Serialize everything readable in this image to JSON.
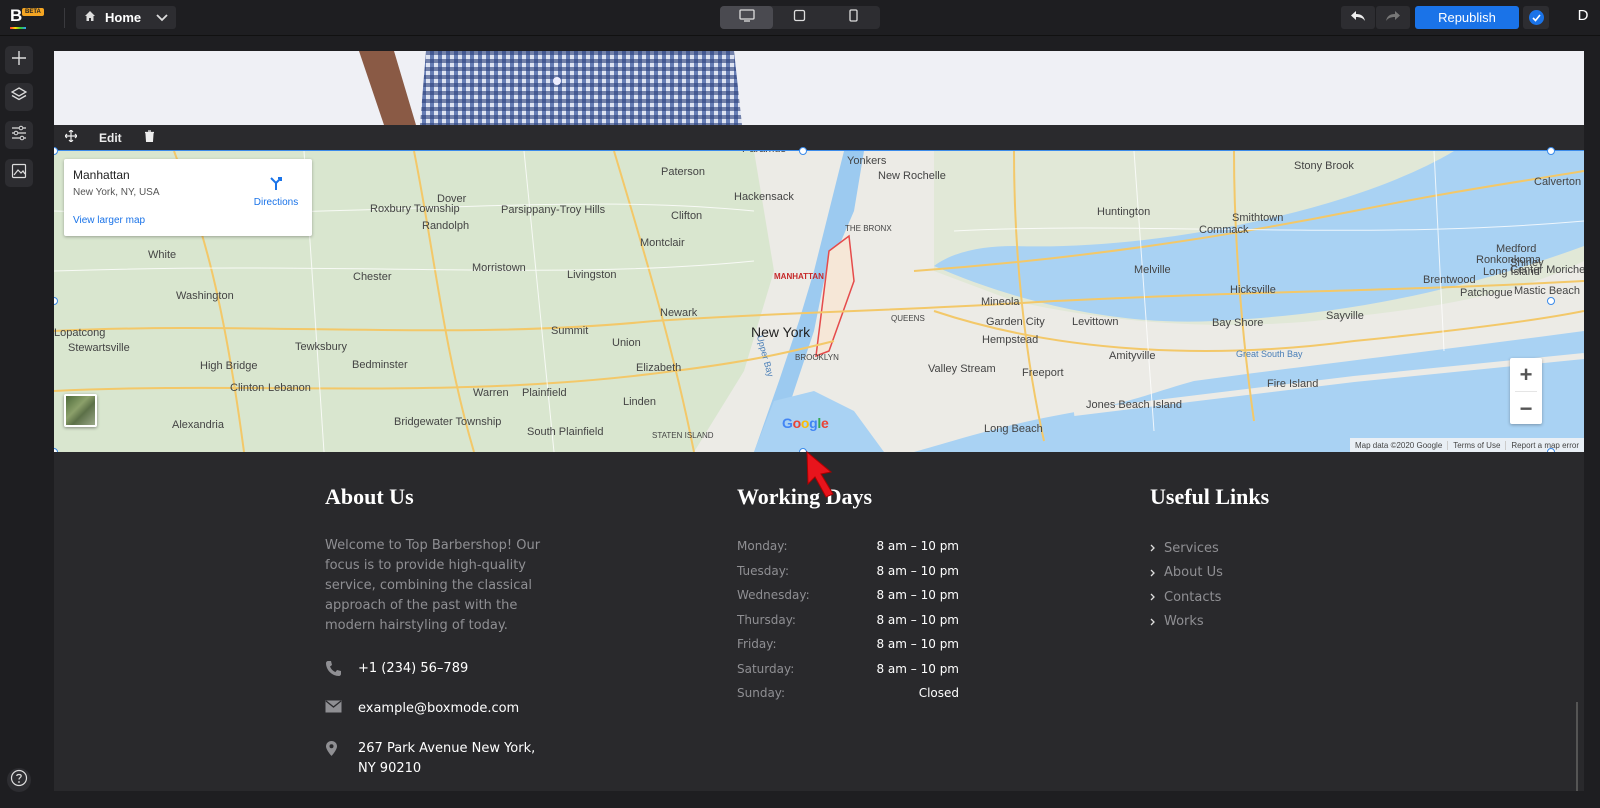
{
  "app": {
    "logo": "B",
    "beta": "BETA",
    "avatar_initial": "D"
  },
  "toolbar": {
    "page_select": "Home",
    "republish": "Republish"
  },
  "editbar": {
    "edit_label": "Edit"
  },
  "map": {
    "card_title": "Manhattan",
    "card_subtitle": "New York, NY, USA",
    "card_link": "View larger map",
    "directions": "Directions",
    "google": [
      "G",
      "o",
      "o",
      "g",
      "l",
      "e"
    ],
    "attribution": [
      "Map data ©2020 Google",
      "Terms of Use",
      "Report a map error"
    ],
    "labels": [
      "Paramus",
      "Yonkers",
      "New Rochelle",
      "Paterson",
      "Hackensack",
      "Dover",
      "Roxbury Township",
      "Parsippany-Troy Hills",
      "Clifton",
      "Randolph",
      "Montclair",
      "Huntington",
      "Smithtown",
      "Commack",
      "Stony Brook",
      "Calverton",
      "Medford",
      "Ronkonkoma",
      "Long Island",
      "Shirley",
      "Center Moriches",
      "Mastic Beach",
      "Patchogue",
      "Brentwood",
      "Melville",
      "Hicksville",
      "THE BRONX",
      "MANHATTAN",
      "Morristown",
      "Livingston",
      "Chester",
      "Washington",
      "White",
      "Newark",
      "New York",
      "QUEENS",
      "BROOKLYN",
      "Mineola",
      "Garden City",
      "Levittown",
      "Hempstead",
      "Bay Shore",
      "Sayville",
      "Lopatcong",
      "Stewartsville",
      "Tewksbury",
      "Bedminster",
      "Summit",
      "Union",
      "Elizabeth",
      "Valley Stream",
      "Freeport",
      "Amityville",
      "Great South Bay",
      "Fire Island",
      "High Bridge",
      "Clinton",
      "Lebanon",
      "Warren",
      "Plainfield",
      "Linden",
      "Jones Beach Island",
      "Long Beach",
      "Alexandria",
      "Bridgewater Township",
      "South Plainfield",
      "STATEN ISLAND",
      "Upper Bay"
    ]
  },
  "footer": {
    "about": {
      "title": "About Us",
      "text": "Welcome to Top Barbershop! Our focus is to provide high-quality service, combining the classical approach of the past with the modern hairstyling of today.",
      "phone": "+1 (234) 56–789",
      "email": "example@boxmode.com",
      "address": "267 Park Avenue New York, NY 90210"
    },
    "hours": {
      "title": "Working Days",
      "days": [
        {
          "day": "Monday:",
          "hours": "8 am – 10 pm"
        },
        {
          "day": "Tuesday:",
          "hours": "8 am – 10 pm"
        },
        {
          "day": "Wednesday:",
          "hours": "8 am – 10 pm"
        },
        {
          "day": "Thursday:",
          "hours": "8 am – 10 pm"
        },
        {
          "day": "Friday:",
          "hours": "8 am – 10 pm"
        },
        {
          "day": "Saturday:",
          "hours": "8 am – 10 pm"
        },
        {
          "day": "Sunday:",
          "hours": "Closed"
        }
      ]
    },
    "links": {
      "title": "Useful Links",
      "items": [
        "Services",
        "About Us",
        "Contacts",
        "Works"
      ]
    }
  },
  "colors": {
    "accent": "#1a73e8",
    "selection": "#3b8bea",
    "footer_bg": "#29292c",
    "cursor": "#e8141c"
  }
}
